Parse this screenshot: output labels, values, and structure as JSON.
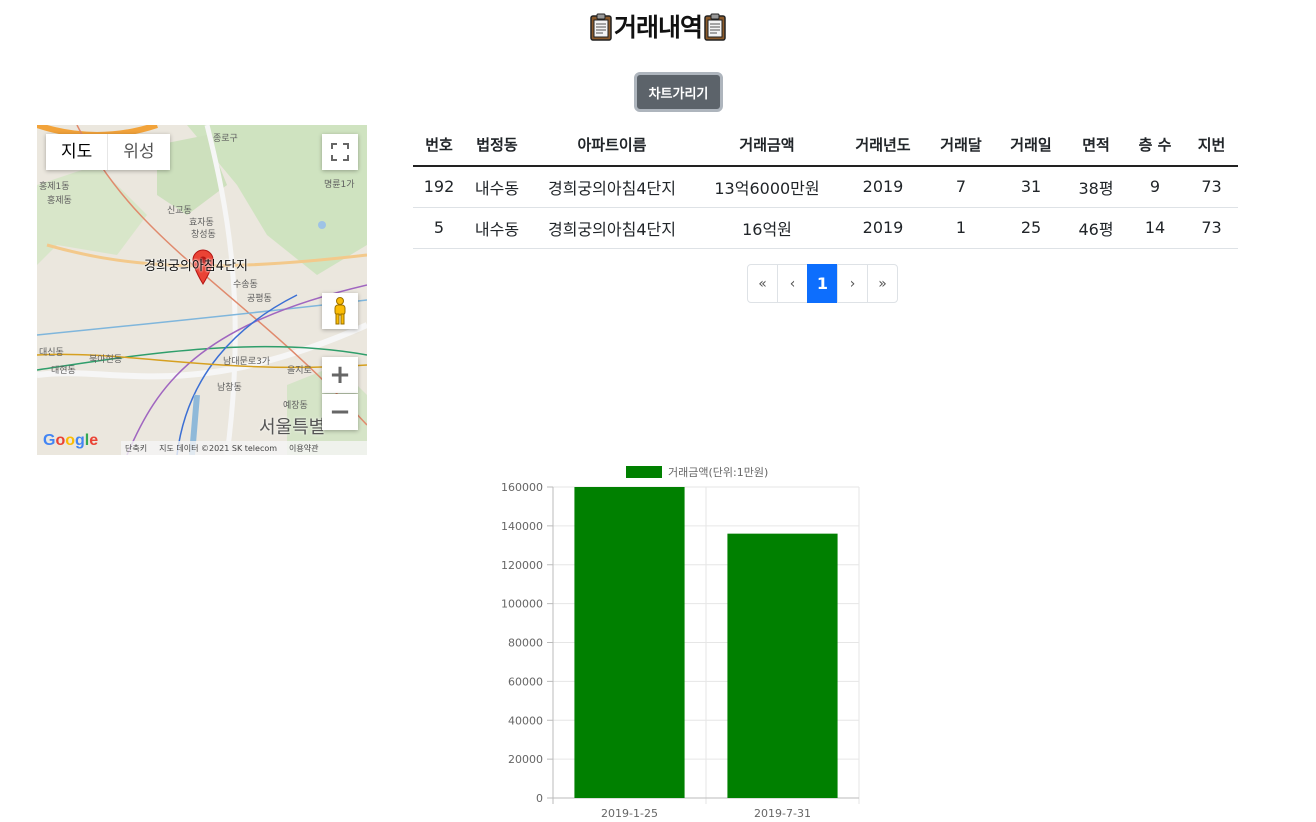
{
  "page": {
    "title": "거래내역"
  },
  "toolbar": {
    "hide_chart_label": "차트가리기"
  },
  "map": {
    "type_buttons": [
      "지도",
      "위성"
    ],
    "place_label": "경희궁의아침4단지",
    "city_label": "서울특별",
    "labels": [
      "종로구",
      "홍제1동",
      "홍제동",
      "신교동",
      "효자동",
      "창성동",
      "명륜1가",
      "수송동",
      "공평동",
      "대신동",
      "북아현동",
      "대현동",
      "남대문로3가",
      "남창동",
      "예장동",
      "을지로"
    ],
    "footer": [
      "단축키",
      "지도 데이터 ©2021 SK telecom",
      "이용약관"
    ],
    "logo": "Google",
    "icons": [
      "fullscreen-icon",
      "pegman-icon",
      "zoom-in-icon",
      "zoom-out-icon",
      "map-pin-icon"
    ],
    "pin_color": "#ea4335"
  },
  "table": {
    "headers": [
      "번호",
      "법정동",
      "아파트이름",
      "거래금액",
      "거래년도",
      "거래달",
      "거래일",
      "면적",
      "층 수",
      "지번"
    ],
    "rows": [
      [
        "192",
        "내수동",
        "경희궁의아침4단지",
        "13억6000만원",
        "2019",
        "7",
        "31",
        "38평",
        "9",
        "73"
      ],
      [
        "5",
        "내수동",
        "경희궁의아침4단지",
        "16억원",
        "2019",
        "1",
        "25",
        "46평",
        "14",
        "73"
      ]
    ]
  },
  "pagination": {
    "first": "«",
    "prev": "‹",
    "current": "1",
    "next": "›",
    "last": "»"
  },
  "chart_data": {
    "type": "bar",
    "categories": [
      "2019-1-25",
      "2019-7-31"
    ],
    "series": [
      {
        "name": "거래금액(단위:1만원)",
        "values": [
          160000,
          136000
        ],
        "color": "#008000"
      }
    ],
    "ylim": [
      0,
      160000
    ],
    "yticks": [
      0,
      20000,
      40000,
      60000,
      80000,
      100000,
      120000,
      140000,
      160000
    ],
    "grid": true,
    "legend": "top"
  },
  "colors": {
    "accent": "#0d6efd",
    "button": "#5c636a",
    "bar": "#008000"
  }
}
